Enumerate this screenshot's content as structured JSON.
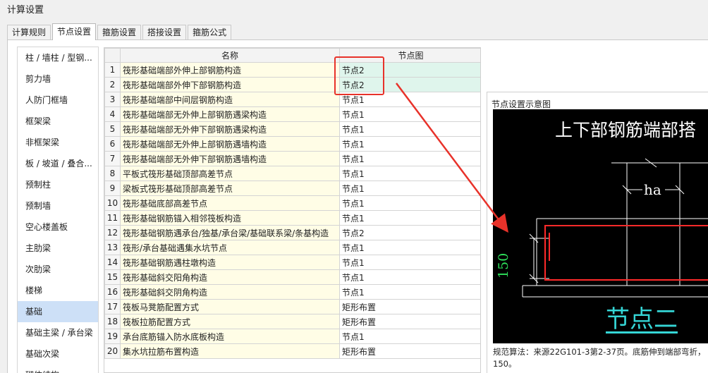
{
  "window": {
    "title": "计算设置"
  },
  "tabs": [
    {
      "label": "计算规则"
    },
    {
      "label": "节点设置"
    },
    {
      "label": "箍筋设置"
    },
    {
      "label": "搭接设置"
    },
    {
      "label": "箍筋公式"
    }
  ],
  "sidebar": {
    "items": [
      {
        "label": "柱 / 墙柱 / 型钢..."
      },
      {
        "label": "剪力墙"
      },
      {
        "label": "人防门框墙"
      },
      {
        "label": "框架梁"
      },
      {
        "label": "非框架梁"
      },
      {
        "label": "板 / 坡道 / 叠合..."
      },
      {
        "label": "预制柱"
      },
      {
        "label": "预制墙"
      },
      {
        "label": "空心楼盖板"
      },
      {
        "label": "主肋梁"
      },
      {
        "label": "次肋梁"
      },
      {
        "label": "楼梯"
      },
      {
        "label": "基础"
      },
      {
        "label": "基础主梁 / 承台梁"
      },
      {
        "label": "基础次梁"
      },
      {
        "label": "砌体结构"
      }
    ],
    "active_index": 12
  },
  "grid": {
    "headers": {
      "name": "名称",
      "node": "节点图"
    },
    "rows": [
      {
        "no": "1",
        "name": "筏形基础端部外伸上部钢筋构造",
        "node": "节点2"
      },
      {
        "no": "2",
        "name": "筏形基础端部外伸下部钢筋构造",
        "node": "节点2"
      },
      {
        "no": "3",
        "name": "筏形基础端部中间层钢筋构造",
        "node": "节点1"
      },
      {
        "no": "4",
        "name": "筏形基础端部无外伸上部钢筋遇梁构造",
        "node": "节点1"
      },
      {
        "no": "5",
        "name": "筏形基础端部无外伸下部钢筋遇梁构造",
        "node": "节点1"
      },
      {
        "no": "6",
        "name": "筏形基础端部无外伸上部钢筋遇墙构造",
        "node": "节点1"
      },
      {
        "no": "7",
        "name": "筏形基础端部无外伸下部钢筋遇墙构造",
        "node": "节点1"
      },
      {
        "no": "8",
        "name": "平板式筏形基础顶部高差节点",
        "node": "节点1"
      },
      {
        "no": "9",
        "name": "梁板式筏形基础顶部高差节点",
        "node": "节点1"
      },
      {
        "no": "10",
        "name": "筏形基础底部高差节点",
        "node": "节点1"
      },
      {
        "no": "11",
        "name": "筏形基础钢筋锚入相邻筏板构造",
        "node": "节点1"
      },
      {
        "no": "12",
        "name": "筏形基础钢筋遇承台/独基/承台梁/基础联系梁/条基构造",
        "node": "节点2"
      },
      {
        "no": "13",
        "name": "筏形/承台基础遇集水坑节点",
        "node": "节点1"
      },
      {
        "no": "14",
        "name": "筏形基础钢筋遇柱墩构造",
        "node": "节点1"
      },
      {
        "no": "15",
        "name": "筏形基础斜交阳角构造",
        "node": "节点1"
      },
      {
        "no": "16",
        "name": "筏形基础斜交阴角构造",
        "node": "节点1"
      },
      {
        "no": "17",
        "name": "筏板马凳筋配置方式",
        "node": "矩形布置"
      },
      {
        "no": "18",
        "name": "筏板拉筋配置方式",
        "node": "矩形布置"
      },
      {
        "no": "19",
        "name": "承台底筋锚入防水底板构造",
        "node": "节点1"
      },
      {
        "no": "20",
        "name": "集水坑拉筋布置构造",
        "node": "矩形布置"
      }
    ],
    "highlight_rows": [
      0,
      1
    ]
  },
  "preview": {
    "title": "节点设置示意图",
    "heading": "上下部钢筋端部搭",
    "dim_ha": "ha",
    "dim_150": "150",
    "node_label": "节点二",
    "rule_line1": "规范算法：来源22G101-3第2-37页。底筋伸到端部弯折，",
    "rule_line2": "150。"
  },
  "colors": {
    "accent_red": "#e8322a",
    "highlight_green": "#dff5ec",
    "name_cell_yellow": "#fffde6",
    "sidebar_active": "#cde0f7"
  }
}
